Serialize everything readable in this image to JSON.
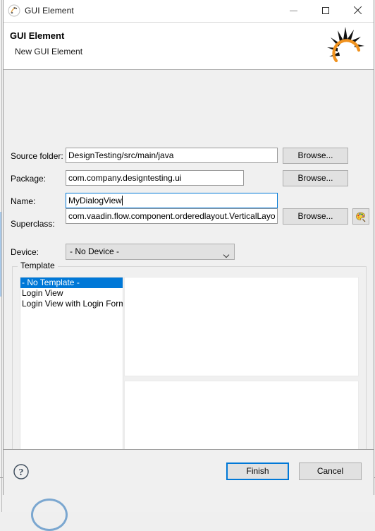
{
  "window": {
    "title": "GUI Element",
    "icon": "gui-element-icon",
    "controls": {
      "minimize": "minimize-icon",
      "maximize": "maximize-icon",
      "close": "close-icon"
    }
  },
  "header": {
    "title": "GUI Element",
    "subtitle": "New GUI Element",
    "logo": "sunrise-logo-icon",
    "logo_color": "#F0921E"
  },
  "form": {
    "source_folder": {
      "label": "Source folder:",
      "value": "DesignTesting/src/main/java",
      "browse_label": "Browse..."
    },
    "package": {
      "label": "Package:",
      "value": "com.company.designtesting.ui",
      "browse_label": "Browse..."
    },
    "name": {
      "label": "Name:",
      "value": "MyDialogView",
      "focused": true
    },
    "superclass": {
      "label": "Superclass:",
      "value": "com.vaadin.flow.component.orderedlayout.VerticalLayo",
      "browse_label": "Browse...",
      "palette_icon": "color-palette-icon"
    }
  },
  "device": {
    "label": "Device:",
    "selected": "- No Device -",
    "chevron": "chevron-down-icon"
  },
  "template": {
    "group_label": "Template",
    "items": [
      {
        "label": "- No Template -",
        "selected": true
      },
      {
        "label": "Login View",
        "selected": false
      },
      {
        "label": "Login View with Login Form",
        "selected": false
      }
    ],
    "selection_color": "#0078D7"
  },
  "footer": {
    "help_icon": "help-question-icon",
    "finish_label": "Finish",
    "cancel_label": "Cancel",
    "default_button": "Finish"
  }
}
